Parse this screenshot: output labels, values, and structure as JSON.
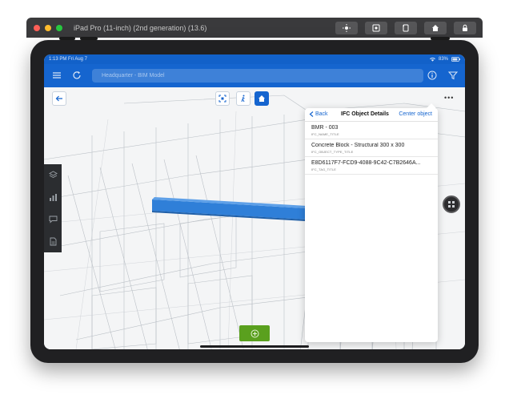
{
  "simulator": {
    "title": "iPad Pro (11-inch) (2nd generation) (13.6)",
    "tools": [
      {
        "icon": "brightness-icon"
      },
      {
        "icon": "screenshot-icon"
      },
      {
        "icon": "rotate-icon"
      },
      {
        "icon": "home-icon"
      },
      {
        "icon": "lock-icon"
      }
    ]
  },
  "status_bar": {
    "time_date": "1:13 PM  Fri Aug 7",
    "battery": "83%"
  },
  "nav": {
    "search_placeholder": "Headquarter - BIM Model"
  },
  "popover": {
    "back_label": "Back",
    "title": "IFC Object Details",
    "action_label": "Center object",
    "rows": [
      {
        "value": "BMR - 003",
        "label": "IFC_NAME_TITLE"
      },
      {
        "value": "Concrete Block - Structural 300 x 300",
        "label": "IFC_OBJECT_TYPE_TITLE"
      },
      {
        "value": "E8D6117F7-FCD9-4088-9C42-C7B2646A...",
        "label": "IFC_TAG_TITLE"
      }
    ]
  },
  "colors": {
    "primary": "#1565cf",
    "highlight_beam": "#2f7fd8",
    "action_green": "#5aa01e"
  }
}
